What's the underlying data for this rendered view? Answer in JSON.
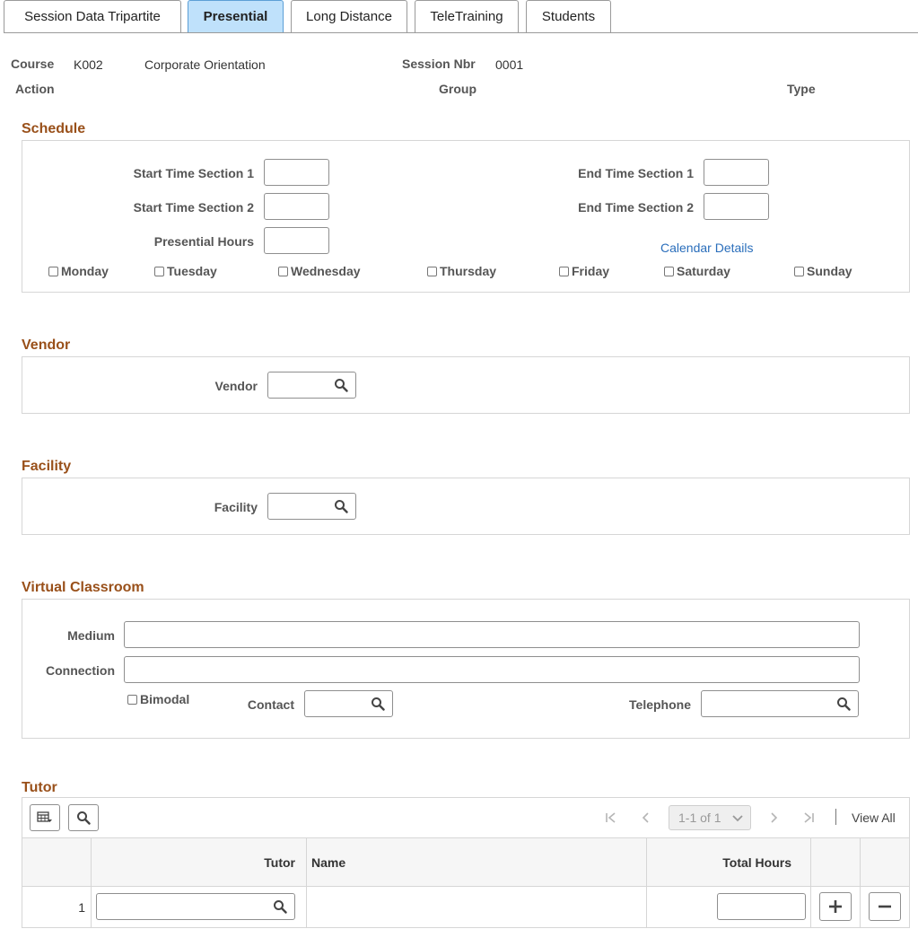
{
  "tabs": [
    {
      "label": "Session Data Tripartite",
      "active": false
    },
    {
      "label": "Presential",
      "active": true
    },
    {
      "label": "Long Distance",
      "active": false
    },
    {
      "label": "TeleTraining",
      "active": false
    },
    {
      "label": "Students",
      "active": false
    }
  ],
  "header": {
    "course_label": "Course",
    "course_code": "K002",
    "course_name": "Corporate Orientation",
    "session_label": "Session Nbr",
    "session_value": "0001",
    "action_label": "Action",
    "group_label": "Group",
    "type_label": "Type"
  },
  "schedule": {
    "title": "Schedule",
    "start1_label": "Start Time Section 1",
    "start2_label": "Start Time Section 2",
    "hours_label": "Presential Hours",
    "end1_label": "End Time Section 1",
    "end2_label": "End Time Section 2",
    "calendar_link": "Calendar Details",
    "days": [
      "Monday",
      "Tuesday",
      "Wednesday",
      "Thursday",
      "Friday",
      "Saturday",
      "Sunday"
    ]
  },
  "vendor": {
    "title": "Vendor",
    "label": "Vendor"
  },
  "facility": {
    "title": "Facility",
    "label": "Facility"
  },
  "virtual": {
    "title": "Virtual Classroom",
    "medium_label": "Medium",
    "connection_label": "Connection",
    "bimodal_label": "Bimodal",
    "contact_label": "Contact",
    "telephone_label": "Telephone"
  },
  "tutor": {
    "title": "Tutor",
    "pager": "1-1 of 1",
    "view_all": "View All",
    "columns": {
      "tutor": "Tutor",
      "name": "Name",
      "total_hours": "Total Hours"
    },
    "rows": [
      {
        "num": "1"
      }
    ]
  },
  "colors": {
    "accent_title": "#99501a",
    "active_tab": "#bfe1fb",
    "link": "#2a6ebb"
  }
}
